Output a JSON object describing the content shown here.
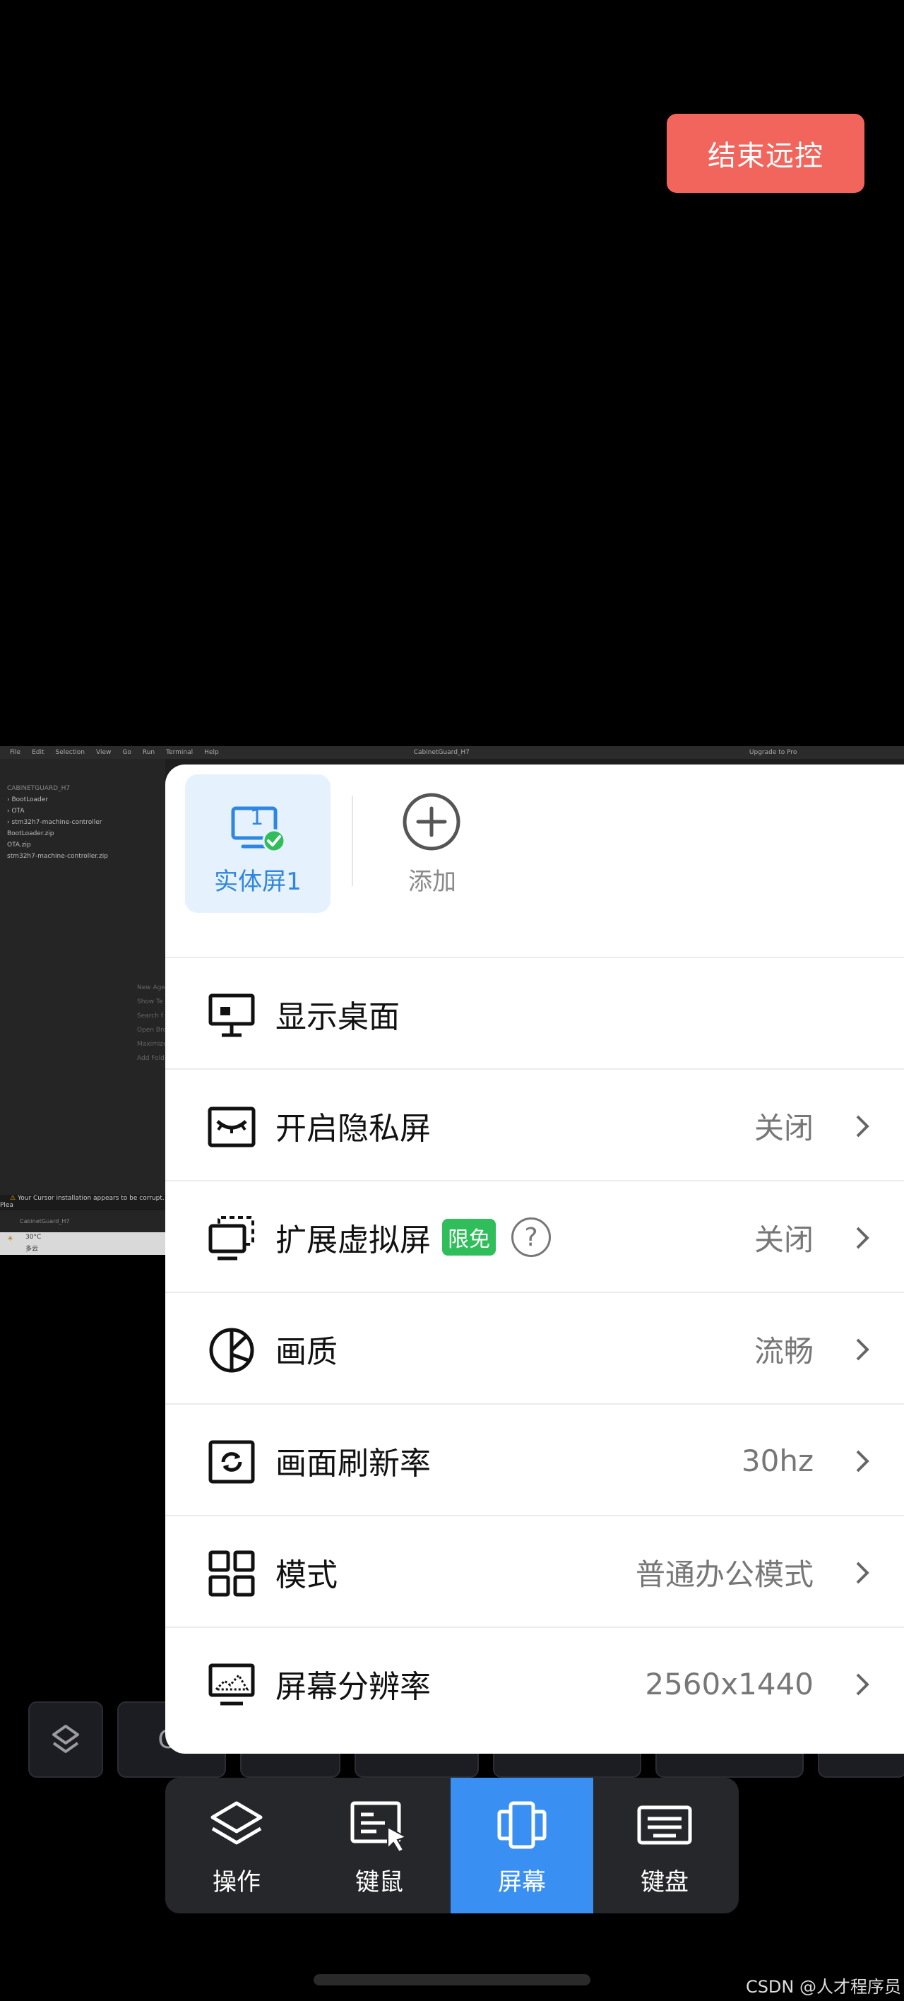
{
  "end_button": {
    "label": "结束远控"
  },
  "remote_desktop": {
    "menu": [
      "File",
      "Edit",
      "Selection",
      "View",
      "Go",
      "Run",
      "Terminal",
      "Help"
    ],
    "window_title": "CabinetGuard_H7",
    "upgrade": "Upgrade to Pro",
    "tree": [
      "CABINETGUARD_H7",
      "› BootLoader",
      "› OTA",
      "› stm32h7-machine-controller",
      "BootLoader.zip",
      "OTA.zip",
      "stm32h7-machine-controller.zip"
    ],
    "hints": [
      "New Agent",
      "Show Te",
      "Search f",
      "Open Bro",
      "Maximize",
      "Add Fold"
    ],
    "warning": "Your Cursor installation appears to be corrupt. Plea",
    "status": "CabinetGuard_H7",
    "weather": "30°C",
    "weather_desc": "多云"
  },
  "keyboard_row": {
    "ctrl_label": "Ct"
  },
  "panel": {
    "screen_tile": {
      "number": "1",
      "label": "实体屏1"
    },
    "add": {
      "label": "添加"
    },
    "rows": [
      {
        "label": "显示桌面",
        "value": "",
        "icon": "monitor-icon"
      },
      {
        "label": "开启隐私屏",
        "value": "关闭",
        "icon": "eye-closed-icon"
      },
      {
        "label": "扩展虚拟屏",
        "badge": "限免",
        "help": "?",
        "value": "关闭",
        "icon": "virtual-screen-icon"
      },
      {
        "label": "画质",
        "value": "流畅",
        "icon": "quality-icon"
      },
      {
        "label": "画面刷新率",
        "value": "30hz",
        "icon": "refresh-icon"
      },
      {
        "label": "模式",
        "value": "普通办公模式",
        "icon": "grid-mode-icon"
      },
      {
        "label": "屏幕分辨率",
        "value": "2560x1440",
        "icon": "resolution-icon"
      }
    ]
  },
  "tabbar": {
    "tabs": [
      {
        "label": "操作",
        "icon": "layers-icon"
      },
      {
        "label": "键鼠",
        "icon": "keyboard-mouse-icon"
      },
      {
        "label": "屏幕",
        "icon": "screen-icon",
        "active": true
      },
      {
        "label": "键盘",
        "icon": "keyboard-icon"
      }
    ]
  },
  "watermark": "CSDN @人才程序员",
  "colors": {
    "accent": "#3a8ff2",
    "end_button": "#f2655c",
    "badge": "#2fbe5a"
  }
}
